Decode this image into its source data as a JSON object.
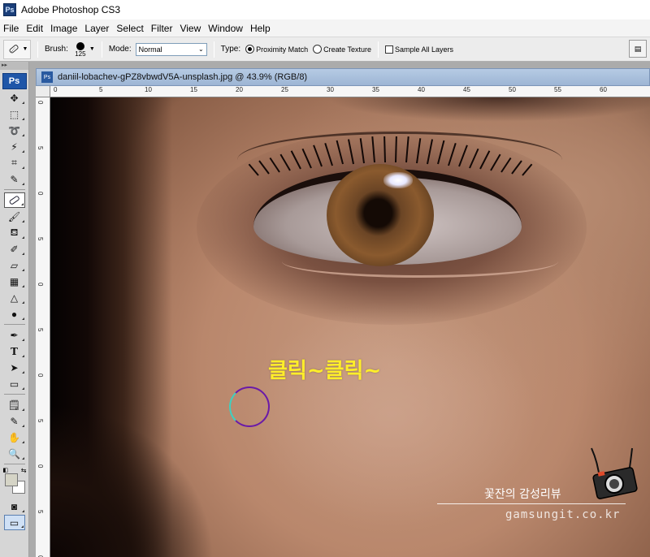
{
  "app": {
    "title": "Adobe Photoshop CS3",
    "logo_text": "Ps"
  },
  "menu": [
    "File",
    "Edit",
    "Image",
    "Layer",
    "Select",
    "Filter",
    "View",
    "Window",
    "Help"
  ],
  "options": {
    "brush_label": "Brush:",
    "brush_size": "125",
    "mode_label": "Mode:",
    "mode_value": "Normal",
    "type_label": "Type:",
    "type_options": [
      "Proximity Match",
      "Create Texture"
    ],
    "type_selected": "Proximity Match",
    "sample_all_layers_label": "Sample All Layers",
    "sample_all_layers_checked": false
  },
  "toolbox": {
    "badge": "Ps",
    "tools": [
      "move-tool",
      "marquee-tool",
      "lasso-tool",
      "magic-wand-tool",
      "crop-tool",
      "slice-tool",
      "spot-healing-brush-tool",
      "brush-tool",
      "clone-stamp-tool",
      "history-brush-tool",
      "eraser-tool",
      "gradient-tool",
      "blur-tool",
      "dodge-tool",
      "pen-tool",
      "type-tool",
      "path-selection-tool",
      "shape-tool",
      "notes-tool",
      "eyedropper-tool",
      "hand-tool",
      "zoom-tool"
    ],
    "active_tool": "spot-healing-brush-tool",
    "foreground_color": "#d5d4c6",
    "background_color": "#ffffff"
  },
  "document": {
    "title": "daniil-lobachev-gPZ8vbwdV5A-unsplash.jpg @ 43.9% (RGB/8)",
    "zoom": "43.9%",
    "ruler_top": [
      "0",
      "5",
      "10",
      "15",
      "20",
      "25",
      "30",
      "35",
      "40",
      "45",
      "50",
      "55",
      "60"
    ],
    "ruler_left": [
      "0",
      "5",
      "0",
      "5",
      "0",
      "5",
      "0",
      "5",
      "0",
      "5",
      "0"
    ]
  },
  "canvas": {
    "overlay_text": "클릭~클릭~",
    "overlay_color": "#ffee2a",
    "watermark_brand": "꽃잔의 감성리뷰",
    "watermark_url": "gamsungit.co.kr"
  }
}
